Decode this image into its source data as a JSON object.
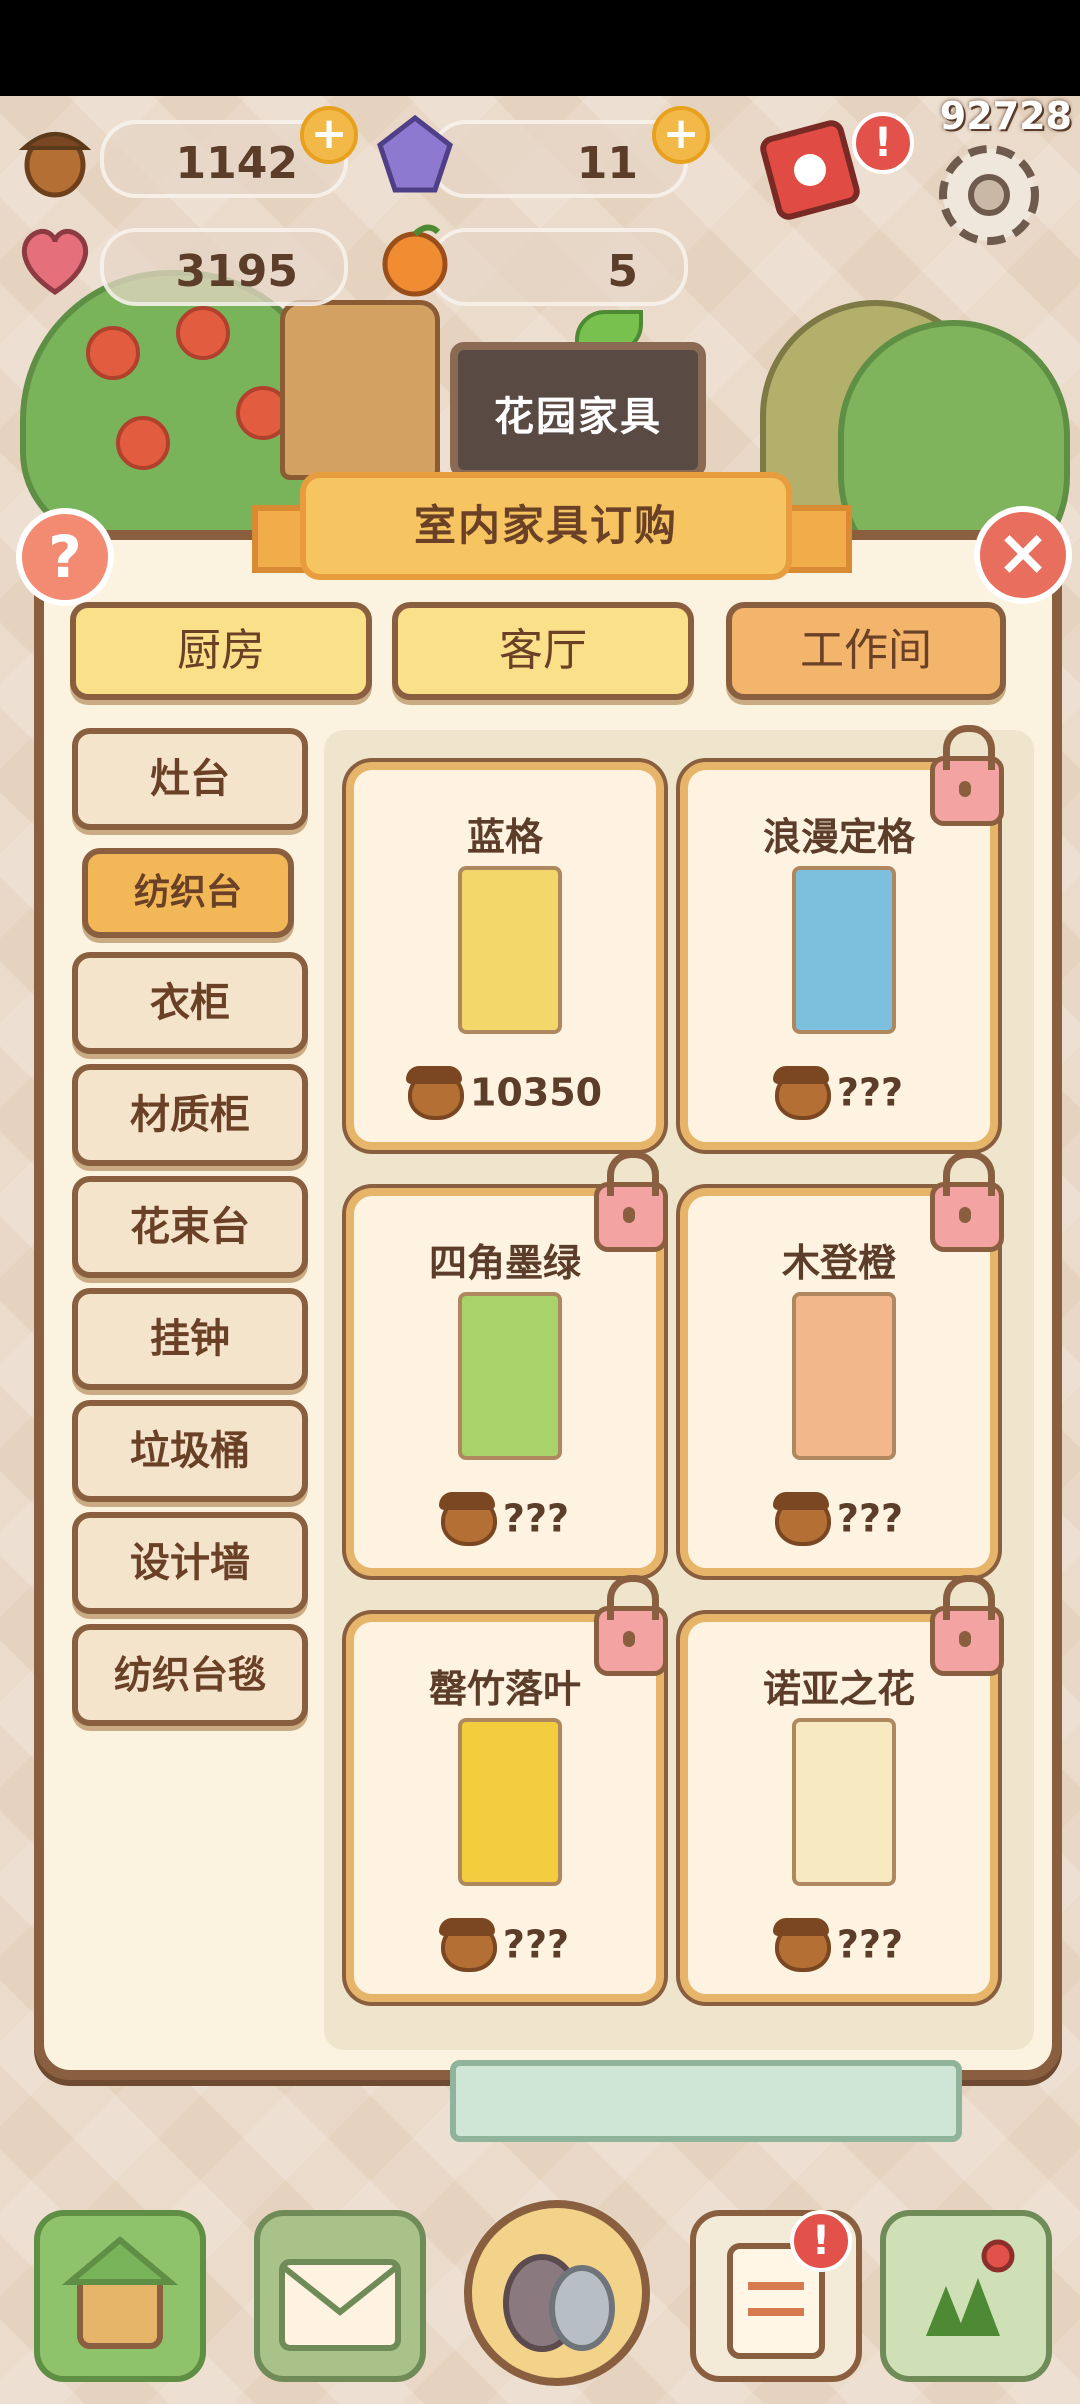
{
  "top_number": "92728",
  "resources": {
    "acorns": "1142",
    "gems": "11",
    "hearts": "3195",
    "oranges": "5",
    "plus": "+"
  },
  "scene": {
    "stall_sign": "花园家具"
  },
  "panel": {
    "title": "室内家具订购",
    "help": "?",
    "close": "×",
    "tabs": [
      "厨房",
      "客厅",
      "工作间"
    ],
    "sidebar": [
      "灶台",
      "纺织台",
      "衣柜",
      "材质柜",
      "花束台",
      "挂钟",
      "垃圾桶",
      "设计墙",
      "纺织台毯"
    ],
    "cards": [
      {
        "name": "蓝格",
        "price": "10350",
        "locked": false,
        "color": "#f3d76a"
      },
      {
        "name": "浪漫定格",
        "price": "???",
        "locked": true,
        "color": "#7cc0de"
      },
      {
        "name": "四角墨绿",
        "price": "???",
        "locked": true,
        "color": "#a8d36a"
      },
      {
        "name": "木登橙",
        "price": "???",
        "locked": true,
        "color": "#f2b78a"
      },
      {
        "name": "罄竹落叶",
        "price": "???",
        "locked": true,
        "color": "#f4cd3e"
      },
      {
        "name": "诺亚之花",
        "price": "???",
        "locked": true,
        "color": "#f7e9c0"
      }
    ]
  },
  "alert_mark": "!"
}
